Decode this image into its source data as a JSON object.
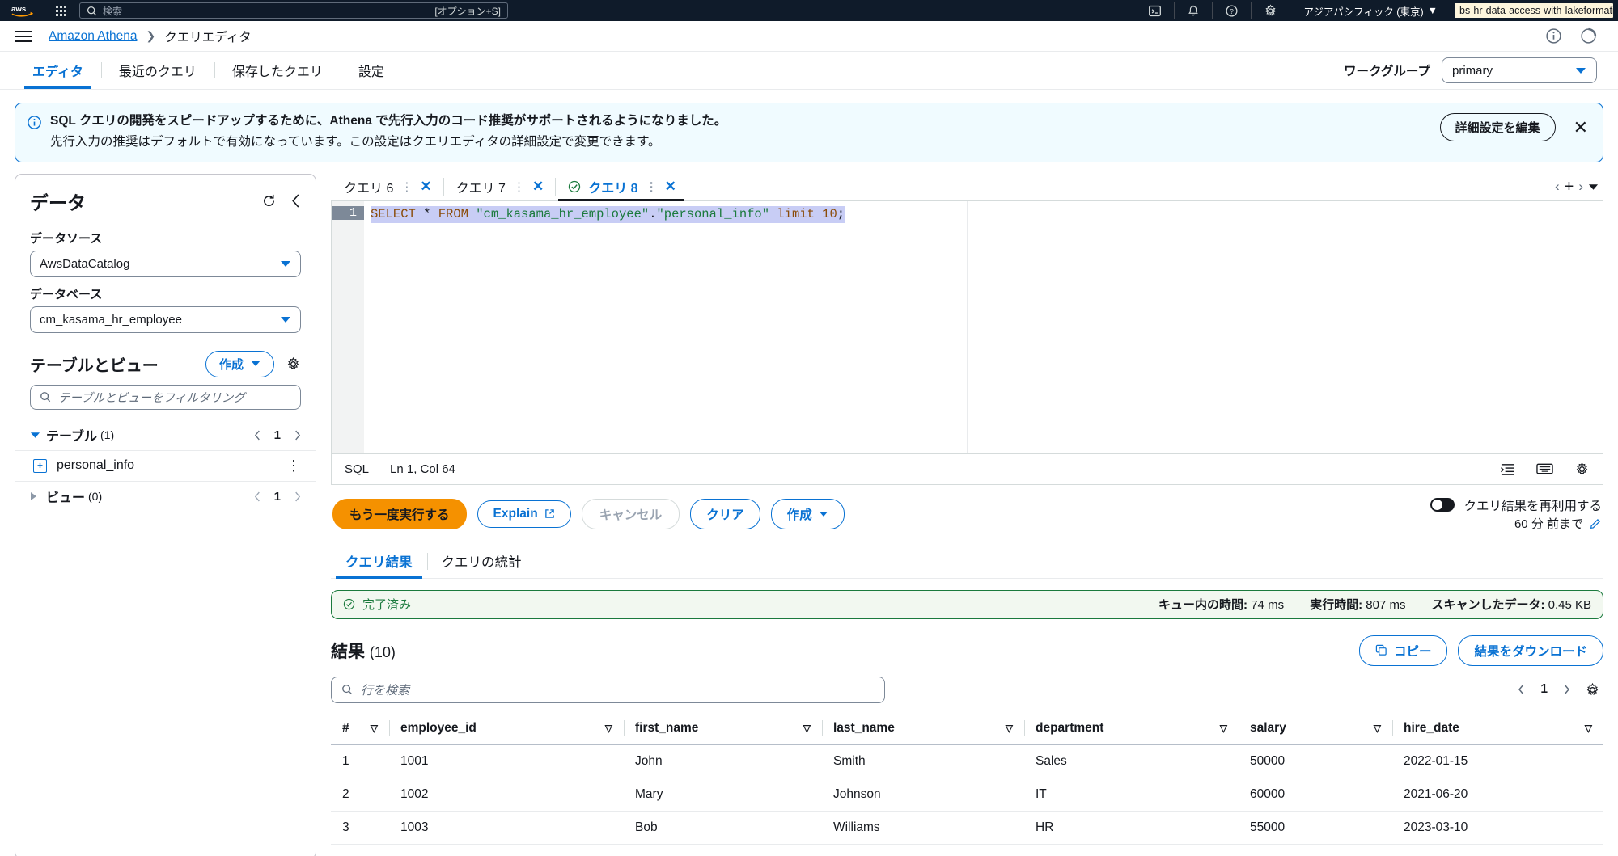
{
  "topnav": {
    "logo": "aws-logo",
    "apps_icon": "app-grid-icon",
    "search_placeholder": "検索",
    "search_shortcut": "[オプション+S]",
    "icons": [
      "cloudshell-icon",
      "notifications-bell-icon",
      "help-question-icon",
      "settings-gear-icon"
    ],
    "region": "アジアパシフィック (東京)",
    "account": "bs-hr-data-access-with-lakeformation"
  },
  "breadcrumb": {
    "menu_icon": "hamburger-menu-icon",
    "service": "Amazon Athena",
    "separator": "❯",
    "current": "クエリエディタ",
    "info_icon": "info-circle-icon",
    "feedback_icon": "feedback-icon"
  },
  "service_tabs": {
    "items": [
      {
        "label": "エディタ",
        "active": true
      },
      {
        "label": "最近のクエリ",
        "active": false
      },
      {
        "label": "保存したクエリ",
        "active": false
      },
      {
        "label": "設定",
        "active": false
      }
    ],
    "workgroup_label": "ワークグループ",
    "workgroup_value": "primary"
  },
  "banner": {
    "icon": "info-circle-icon",
    "title": "SQL クエリの開発をスピードアップするために、Athena で先行入力のコード推奨がサポートされるようになりました。",
    "body": "先行入力の推奨はデフォルトで有効になっています。この設定はクエリエディタの詳細設定で変更できます。",
    "action_label": "詳細設定を編集",
    "close_label": "✕"
  },
  "data_panel": {
    "title": "データ",
    "refresh_icon": "refresh-icon",
    "collapse_icon": "chevron-left-icon",
    "datasource_label": "データソース",
    "datasource_value": "AwsDataCatalog",
    "database_label": "データベース",
    "database_value": "cm_kasama_hr_employee",
    "tables_views_title": "テーブルとビュー",
    "create_button": "作成",
    "settings_icon": "gear-icon",
    "filter_placeholder": "テーブルとビューをフィルタリング",
    "search_icon": "search-icon",
    "tables_group": {
      "label": "テーブル",
      "count": "(1)",
      "page": "1",
      "expanded": true
    },
    "table_items": [
      {
        "name": "personal_info",
        "icon": "table-plus-icon",
        "menu": "kebab-menu-icon"
      }
    ],
    "views_group": {
      "label": "ビュー",
      "count": "(0)",
      "page": "1",
      "expanded": false
    }
  },
  "editor": {
    "tabs": [
      {
        "label": "クエリ 6",
        "active": false,
        "has_status": false
      },
      {
        "label": "クエリ 7",
        "active": false,
        "has_status": false
      },
      {
        "label": "クエリ 8",
        "active": true,
        "has_status": true,
        "status_icon": "success-check-icon"
      }
    ],
    "tab_close_icon": "close-x-icon",
    "tab_menu_icon": "vertical-dots-icon",
    "add_tab_icon": "plus-icon",
    "tab_overflow_icon": "chevron-down-icon",
    "line_number": "1",
    "sql": {
      "full": "SELECT * FROM \"cm_kasama_hr_employee\".\"personal_info\" limit 10;",
      "tokens": [
        {
          "t": "SELECT",
          "c": "kw"
        },
        {
          "t": " ",
          "c": "op"
        },
        {
          "t": "*",
          "c": "op"
        },
        {
          "t": " ",
          "c": "op"
        },
        {
          "t": "FROM",
          "c": "kw"
        },
        {
          "t": " ",
          "c": "op"
        },
        {
          "t": "\"cm_kasama_hr_employee\"",
          "c": "str"
        },
        {
          "t": ".",
          "c": "op"
        },
        {
          "t": "\"personal_info\"",
          "c": "str"
        },
        {
          "t": " ",
          "c": "op"
        },
        {
          "t": "limit",
          "c": "kw"
        },
        {
          "t": " ",
          "c": "op"
        },
        {
          "t": "10",
          "c": "num"
        },
        {
          "t": ";",
          "c": "op"
        }
      ]
    },
    "status_language": "SQL",
    "status_position": "Ln 1, Col 64",
    "status_icons": [
      "format-icon",
      "keyboard-icon",
      "editor-settings-gear-icon"
    ]
  },
  "actions": {
    "run_again": "もう一度実行する",
    "explain": "Explain",
    "explain_external_icon": "external-link-icon",
    "cancel": "キャンセル",
    "clear": "クリア",
    "create": "作成",
    "create_caret": "▼",
    "reuse_toggle_on": true,
    "reuse_label": "クエリ結果を再利用する",
    "reuse_duration": "60 分 前まで",
    "reuse_edit_icon": "pencil-edit-icon"
  },
  "results": {
    "tabs": [
      {
        "label": "クエリ結果",
        "active": true
      },
      {
        "label": "クエリの統計",
        "active": false
      }
    ],
    "status": {
      "icon": "success-check-icon",
      "text": "完了済み",
      "metrics": [
        {
          "label": "キュー内の時間:",
          "value": "74 ms"
        },
        {
          "label": "実行時間:",
          "value": "807 ms"
        },
        {
          "label": "スキャンしたデータ:",
          "value": "0.45 KB"
        }
      ]
    },
    "title": "結果",
    "count": "(10)",
    "copy_button": "コピー",
    "copy_icon": "copy-icon",
    "download_button": "結果をダウンロード",
    "row_search_placeholder": "行を検索",
    "row_search_icon": "search-icon",
    "page": "1",
    "prev_icon": "chevron-left-icon",
    "next_icon": "chevron-right-icon",
    "preferences_icon": "gear-icon",
    "sort_icon": "▽",
    "columns": [
      "#",
      "employee_id",
      "first_name",
      "last_name",
      "department",
      "salary",
      "hire_date"
    ],
    "rows": [
      [
        "1",
        "1001",
        "John",
        "Smith",
        "Sales",
        "50000",
        "2022-01-15"
      ],
      [
        "2",
        "1002",
        "Mary",
        "Johnson",
        "IT",
        "60000",
        "2021-06-20"
      ],
      [
        "3",
        "1003",
        "Bob",
        "Williams",
        "HR",
        "55000",
        "2023-03-10"
      ]
    ]
  },
  "colors": {
    "accent_blue": "#0972d3",
    "nav_dark": "#0f1b2a",
    "orange": "#f59100",
    "success_green": "#1b7a3d",
    "account_highlight": "#fdf6dd"
  }
}
